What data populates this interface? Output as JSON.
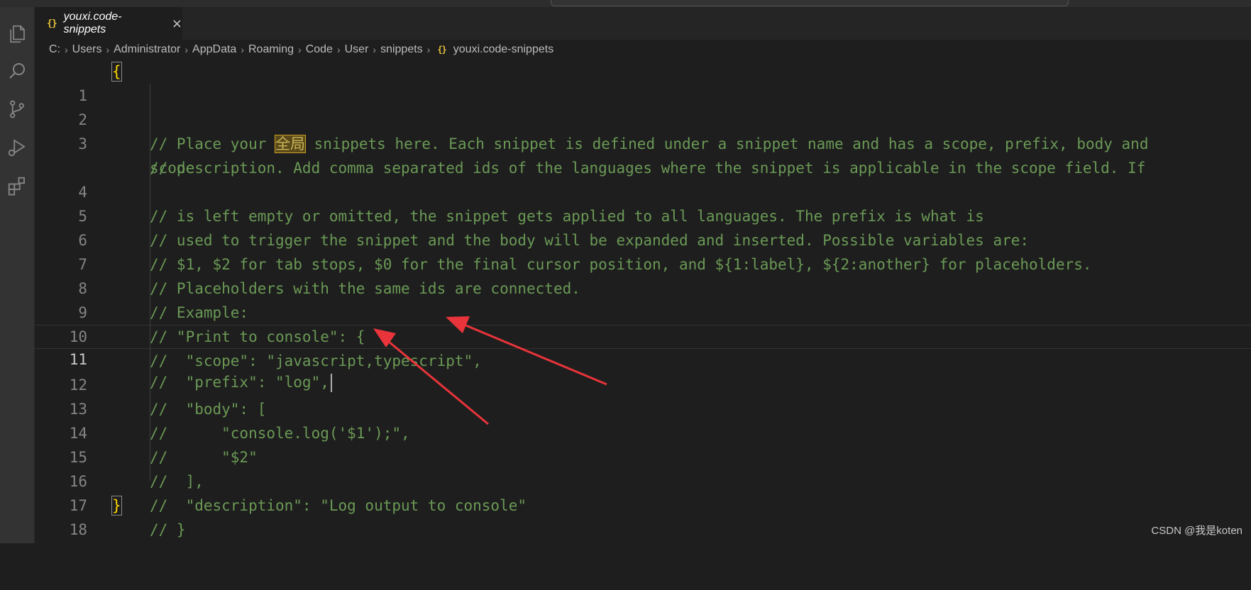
{
  "tab": {
    "icon": "{}",
    "label": "youxi.code-snippets",
    "close": "×"
  },
  "breadcrumb": {
    "items": [
      "C:",
      "Users",
      "Administrator",
      "AppData",
      "Roaming",
      "Code",
      "User",
      "snippets"
    ],
    "file_icon": "{}",
    "file": "youxi.code-snippets"
  },
  "activity_icons": [
    "explorer-icon",
    "search-icon",
    "source-control-icon",
    "run-debug-icon",
    "extensions-icon"
  ],
  "editor": {
    "line_numbers": [
      "1",
      "2",
      "3",
      "4",
      "5",
      "6",
      "7",
      "8",
      "9",
      "10",
      "11",
      "12",
      "13",
      "14",
      "15",
      "16",
      "17",
      "18"
    ],
    "line1": "{",
    "line2_a": "// Place your ",
    "line2_highlight": "全局",
    "line2_b": " snippets here. Each snippet is defined under a snippet name and has a scope, prefix, body and",
    "line3": "// description. Add comma separated ids of the languages where the snippet is applicable in the scope field. If",
    "line3_wrap": "scope",
    "line4": "// is left empty or omitted, the snippet gets applied to all languages. The prefix is what is",
    "line5": "// used to trigger the snippet and the body will be expanded and inserted. Possible variables are:",
    "line6": "// $1, $2 for tab stops, $0 for the final cursor position, and ${1:label}, ${2:another} for placeholders.",
    "line7": "// Placeholders with the same ids are connected.",
    "line8": "// Example:",
    "line9": "// \"Print to console\": {",
    "line10": "//  \"scope\": \"javascript,typescript\",",
    "line11": "//  \"prefix\": \"log\",",
    "line12": "//  \"body\": [",
    "line13": "//      \"console.log('$1');\",",
    "line14": "//      \"$2\"",
    "line15": "//  ],",
    "line16": "//  \"description\": \"Log output to console\"",
    "line17": "// }",
    "line18": "}"
  },
  "watermark": "CSDN @我是koten",
  "colors": {
    "comment": "#6a9955",
    "brace": "#ffd700",
    "arrow": "#e8343a",
    "background": "#1e1e1e"
  }
}
